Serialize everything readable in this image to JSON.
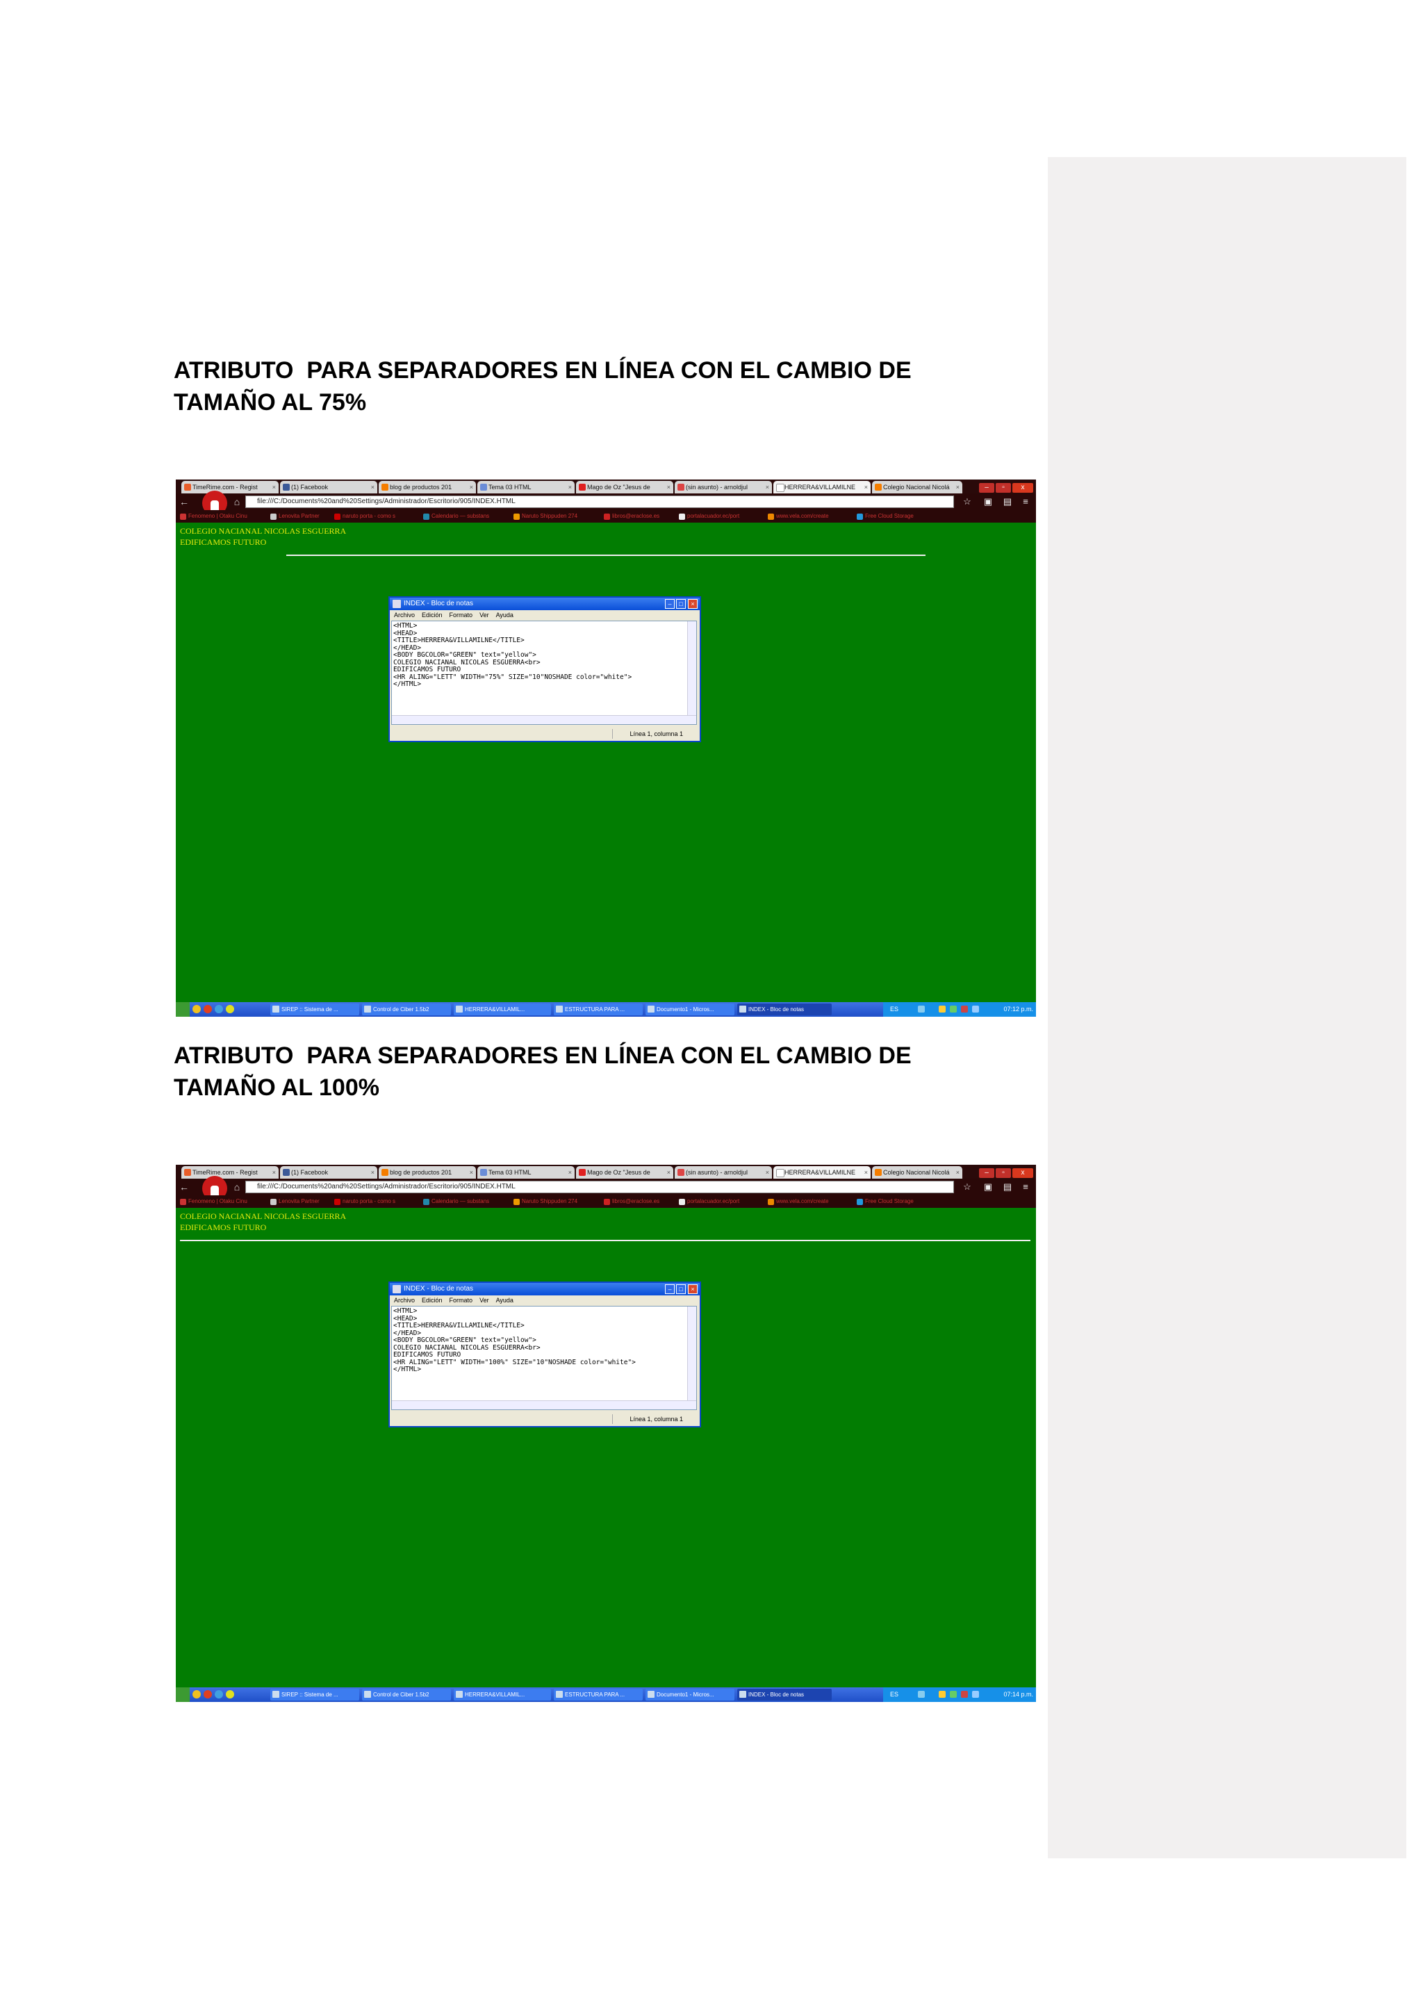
{
  "headings": [
    {
      "line1": "ATRIBUTO  PARA SEPARADORES EN LÍNEA CON EL CAMBIO DE",
      "line2": "TAMAÑO AL 75%"
    },
    {
      "line1": "ATRIBUTO  PARA SEPARADORES EN LÍNEA CON EL CAMBIO DE",
      "line2": "TAMAÑO AL 100%"
    }
  ],
  "browser": {
    "tabs": [
      {
        "label": "TimeRime.com - Regist",
        "color": "#e85d2a"
      },
      {
        "label": "(1) Facebook",
        "color": "#3b5998"
      },
      {
        "label": "blog de productos 201",
        "color": "#f57d00"
      },
      {
        "label": "Tema 03 HTML",
        "color": "#6a8cd8"
      },
      {
        "label": "Mago de Oz \"Jesus de",
        "color": "#e02020"
      },
      {
        "label": "(sin asunto) - arnoldjul",
        "color": "#d44"
      },
      {
        "label": "HERRERA&VILLAMILNE",
        "color": "#ffffff"
      },
      {
        "label": "Colegio Nacional Nicolá",
        "color": "#f57d00"
      }
    ],
    "window_buttons": [
      "–",
      "▫",
      "x"
    ],
    "address": "file:///C:/Documents%20and%20Settings/Administrador/Escritorio/905/INDEX.HTML",
    "bookmarks": [
      {
        "label": "Fenomeno | Otaku Cinu",
        "color": "#c33"
      },
      {
        "label": "Lenovita Partner",
        "color": "#ccc"
      },
      {
        "label": "naruto porta - como s",
        "color": "#c00"
      },
      {
        "label": "Calendario — substans",
        "color": "#28a"
      },
      {
        "label": "Naruto Shippuden 274",
        "color": "#e90"
      },
      {
        "label": "libros@eraclose.es",
        "color": "#c22"
      },
      {
        "label": "portalacuador.ec/port",
        "color": "#eee"
      },
      {
        "label": "www.vela.com/create",
        "color": "#e80"
      },
      {
        "label": "Free Cloud Storage",
        "color": "#29d"
      }
    ]
  },
  "page": {
    "line1": "COLEGIO NACIANAL NICOLAS ESGUERRA",
    "line2": "EDIFICAMOS FUTURO"
  },
  "notepad": {
    "title": "INDEX - Bloc de notas",
    "menu": [
      "Archivo",
      "Edición",
      "Formato",
      "Ver",
      "Ayuda"
    ],
    "code_75": "<HTML>\n<HEAD>\n<TITLE>HERRERA&VILLAMILNE</TITLE>\n</HEAD>\n<BODY BGCOLOR=\"GREEN\" text=\"yellow\">\nCOLEGIO NACIANAL NICOLAS ESGUERRA<br>\nEDIFICAMOS FUTURO\n<HR ALING=\"LETT\" WIDTH=\"75%\" SIZE=\"10\"NOSHADE color=\"white\">\n</HTML>",
    "code_100": "<HTML>\n<HEAD>\n<TITLE>HERRERA&VILLAMILNE</TITLE>\n</HEAD>\n<BODY BGCOLOR=\"GREEN\" text=\"yellow\">\nCOLEGIO NACIANAL NICOLAS ESGUERRA<br>\nEDIFICAMOS FUTURO\n<HR ALING=\"LETT\" WIDTH=\"100%\" SIZE=\"10\"NOSHADE color=\"white\">\n</HTML>",
    "status": "Línea 1, columna 1"
  },
  "taskbar": {
    "tasks": [
      {
        "label": "SIREP :: Sistema de ..."
      },
      {
        "label": "Control de Ciber 1.5b2"
      },
      {
        "label": "HERRERA&VILLAMIL..."
      },
      {
        "label": "ESTRUCTURA PARA ..."
      },
      {
        "label": "Documento1 - Micros..."
      },
      {
        "label": "INDEX - Bloc de notas"
      }
    ],
    "tray_label": "ES",
    "clock_1": "07:12 p.m.",
    "clock_2": "07:14 p.m."
  },
  "colors": {
    "page_bg": "#027d02",
    "page_text": "#e6ea10",
    "hr": "#f0f0f0",
    "comment_margin": "#f2f0f0"
  }
}
